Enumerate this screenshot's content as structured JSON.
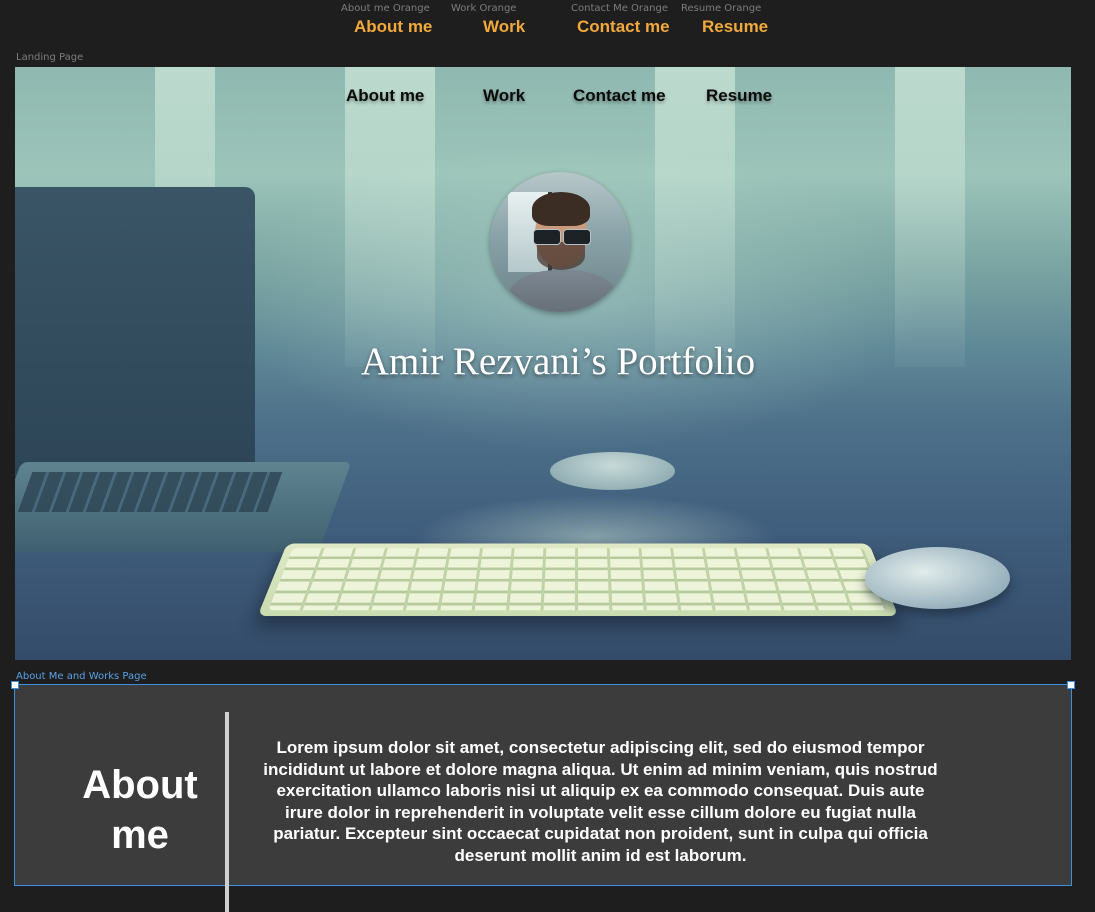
{
  "components": [
    {
      "caption": "About me Orange",
      "label": "About me"
    },
    {
      "caption": "Work Orange",
      "label": "Work"
    },
    {
      "caption": "Contact Me Orange",
      "label": "Contact me"
    },
    {
      "caption": "Resume Orange",
      "label": "Resume"
    }
  ],
  "frames": {
    "landing_label": "Landing Page",
    "about_label": "About Me and Works Page"
  },
  "landing": {
    "nav": [
      "About me",
      "Work",
      "Contact me",
      "Resume"
    ],
    "title": "Amir Rezvani’s Portfolio"
  },
  "about": {
    "heading": "About me",
    "body": "Lorem ipsum dolor sit amet, consectetur adipiscing elit, sed do eiusmod tempor incididunt ut labore et dolore magna aliqua. Ut enim ad minim veniam, quis nostrud exercitation ullamco laboris nisi ut aliquip ex ea commodo consequat. Duis aute irure dolor in reprehenderit in voluptate velit esse cillum dolore eu fugiat nulla pariatur. Excepteur sint occaecat cupidatat non proident, sunt in culpa qui officia deserunt mollit anim id est laborum."
  },
  "colors": {
    "canvas": "#1e1e1e",
    "accent_orange": "#f2a93b",
    "selection": "#3d8fe0",
    "about_bg": "#3c3c3c"
  }
}
